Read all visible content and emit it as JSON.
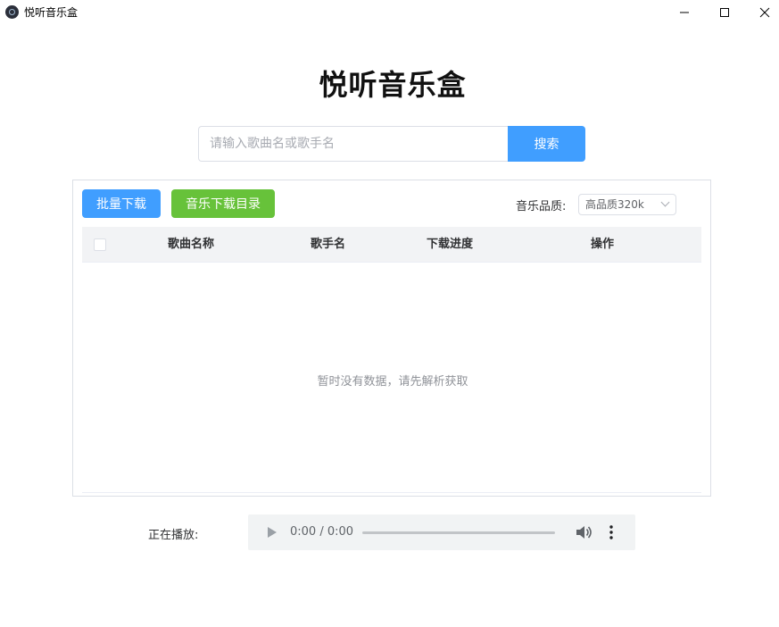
{
  "window": {
    "title": "悦听音乐盒",
    "icon": "app-logo-icon",
    "controls": [
      "minimize-icon",
      "maximize-icon",
      "close-icon"
    ]
  },
  "header": {
    "title": "悦听音乐盒"
  },
  "search": {
    "placeholder": "请输入歌曲名或歌手名",
    "value": "",
    "button_label": "搜索"
  },
  "toolbar": {
    "batch_download_label": "批量下载",
    "download_dir_label": "音乐下载目录",
    "quality_label": "音乐品质:",
    "quality_selected": "高品质320k"
  },
  "table": {
    "columns": [
      "歌曲名称",
      "歌手名",
      "下载进度",
      "操作"
    ],
    "rows": [],
    "empty_text": "暂时没有数据，请先解析获取"
  },
  "player": {
    "label": "正在播放:",
    "time": "0:00 / 0:00"
  },
  "colors": {
    "primary": "#409eff",
    "success": "#67c23a"
  }
}
